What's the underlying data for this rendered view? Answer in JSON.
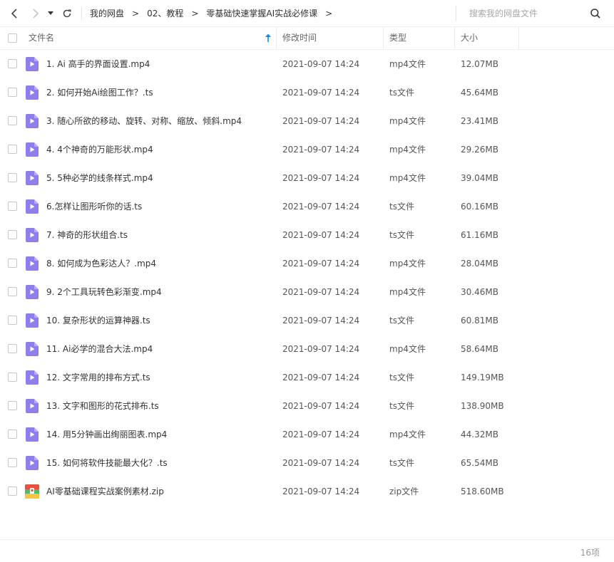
{
  "search": {
    "placeholder": "搜索我的网盘文件"
  },
  "breadcrumb": [
    "我的网盘",
    "02、教程",
    "零基础快速掌握AI实战必修课"
  ],
  "breadcrumb_separator": ">",
  "columns": {
    "name": "文件名",
    "time": "修改时间",
    "type": "类型",
    "size": "大小"
  },
  "files": [
    {
      "name": "1. Ai 高手的界面设置.mp4",
      "time": "2021-09-07 14:24",
      "type": "mp4文件",
      "size": "12.07MB",
      "icon": "video-file-icon"
    },
    {
      "name": "2. 如何开始Ai绘图工作？.ts",
      "time": "2021-09-07 14:24",
      "type": "ts文件",
      "size": "45.64MB",
      "icon": "video-file-icon"
    },
    {
      "name": "3. 随心所欲的移动、旋转、对称、缩放、倾斜.mp4",
      "time": "2021-09-07 14:24",
      "type": "mp4文件",
      "size": "23.41MB",
      "icon": "video-file-icon"
    },
    {
      "name": "4. 4个神奇的万能形状.mp4",
      "time": "2021-09-07 14:24",
      "type": "mp4文件",
      "size": "29.26MB",
      "icon": "video-file-icon"
    },
    {
      "name": "5. 5种必学的线条样式.mp4",
      "time": "2021-09-07 14:24",
      "type": "mp4文件",
      "size": "39.04MB",
      "icon": "video-file-icon"
    },
    {
      "name": "6.怎样让图形听你的话.ts",
      "time": "2021-09-07 14:24",
      "type": "ts文件",
      "size": "60.16MB",
      "icon": "video-file-icon"
    },
    {
      "name": "7. 神奇的形状组合.ts",
      "time": "2021-09-07 14:24",
      "type": "ts文件",
      "size": "61.16MB",
      "icon": "video-file-icon"
    },
    {
      "name": "8. 如何成为色彩达人？.mp4",
      "time": "2021-09-07 14:24",
      "type": "mp4文件",
      "size": "28.04MB",
      "icon": "video-file-icon"
    },
    {
      "name": "9. 2个工具玩转色彩渐变.mp4",
      "time": "2021-09-07 14:24",
      "type": "mp4文件",
      "size": "30.46MB",
      "icon": "video-file-icon"
    },
    {
      "name": "10. 复杂形状的运算神器.ts",
      "time": "2021-09-07 14:24",
      "type": "ts文件",
      "size": "60.81MB",
      "icon": "video-file-icon"
    },
    {
      "name": "11. Ai必学的混合大法.mp4",
      "time": "2021-09-07 14:24",
      "type": "mp4文件",
      "size": "58.64MB",
      "icon": "video-file-icon"
    },
    {
      "name": "12. 文字常用的排布方式.ts",
      "time": "2021-09-07 14:24",
      "type": "ts文件",
      "size": "149.19MB",
      "icon": "video-file-icon"
    },
    {
      "name": "13. 文字和图形的花式排布.ts",
      "time": "2021-09-07 14:24",
      "type": "ts文件",
      "size": "138.90MB",
      "icon": "video-file-icon"
    },
    {
      "name": "14. 用5分钟画出绚丽图表.mp4",
      "time": "2021-09-07 14:24",
      "type": "mp4文件",
      "size": "44.32MB",
      "icon": "video-file-icon"
    },
    {
      "name": "15. 如何将软件技能最大化？.ts",
      "time": "2021-09-07 14:24",
      "type": "ts文件",
      "size": "65.54MB",
      "icon": "video-file-icon"
    },
    {
      "name": "AI零基础课程实战案例素材.zip",
      "time": "2021-09-07 14:24",
      "type": "zip文件",
      "size": "518.60MB",
      "icon": "zip-file-icon"
    }
  ],
  "footer": {
    "count": "16项"
  },
  "colors": {
    "video_icon": "#8d7ff0",
    "accent_blue": "#0e8ee9",
    "zip_red": "#e6523f",
    "zip_green": "#53b96a",
    "zip_yellow": "#f6c443"
  }
}
